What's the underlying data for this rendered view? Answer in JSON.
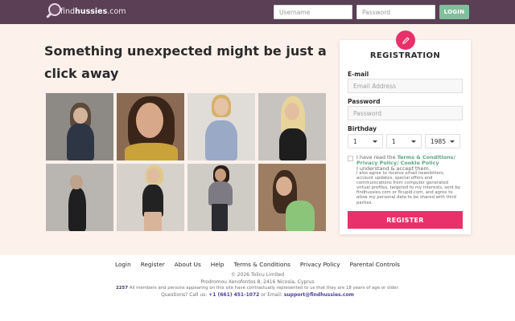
{
  "header": {
    "logo_prefix": "find",
    "logo_bold": "hussies",
    "logo_suffix": ".com",
    "username_placeholder": "Username",
    "password_placeholder": "Password",
    "login_label": "LOGIN"
  },
  "hero": {
    "headline": "Something unexpected might be just a click away"
  },
  "photos": [
    {
      "label": "profile photo 1",
      "bg": "#8d8a86"
    },
    {
      "label": "profile photo 2",
      "bg": "#8a6a52"
    },
    {
      "label": "profile photo 3",
      "bg": "#e0ddd8"
    },
    {
      "label": "profile photo 4",
      "bg": "#c7c3be"
    },
    {
      "label": "profile photo 5",
      "bg": "#b9b6b1"
    },
    {
      "label": "profile photo 6",
      "bg": "#d6d1ca"
    },
    {
      "label": "profile photo 7",
      "bg": "#cfcbc5"
    },
    {
      "label": "profile photo 8",
      "bg": "#9e7e62"
    }
  ],
  "registration": {
    "title": "REGISTRATION",
    "email_label": "E-mail",
    "email_placeholder": "Email Address",
    "password_label": "Password",
    "password_placeholder": "Password",
    "birthday_label": "Birthday",
    "day": "1",
    "month": "1",
    "year": "1985",
    "agree_prefix": "I have read the ",
    "agree_link1": "Terms & Conditions/ Privacy Policy/ Cookie Policy",
    "agree_suffix": "I understand & accept them.",
    "small_print": "I also agree to receive email newsletters, account updates, special offers and communications from computer generated virtual profiles, targeted to my interests, sent by findhussies.com or flcupid.com, and agree to allow my personal data to be shared with third parties.",
    "register_label": "REGISTER"
  },
  "footer": {
    "links": [
      "Login",
      "Register",
      "About Us",
      "Help",
      "Terms & Conditions",
      "Privacy Policy",
      "Parental Controls"
    ],
    "copyright": "© 2026 Tolicu Limited",
    "address": "Prodromou Xenofontos 8, 2416 Nicosia, Cyprus",
    "statute_num": "2257",
    "statute_text": " All members and persons appearing on this site have contractually represented to us that they are 18 years of age or older.",
    "questions_prefix": "Questions? Call us: ",
    "phone": "+1 (661) 451-1072",
    "questions_mid": " or Email: ",
    "email": "support@findhussies.com"
  },
  "colors": {
    "topbar": "#5a3f55",
    "accent_pink": "#e8306b",
    "login_green": "#7fbf9b",
    "page_bg": "#fdf1ec"
  }
}
